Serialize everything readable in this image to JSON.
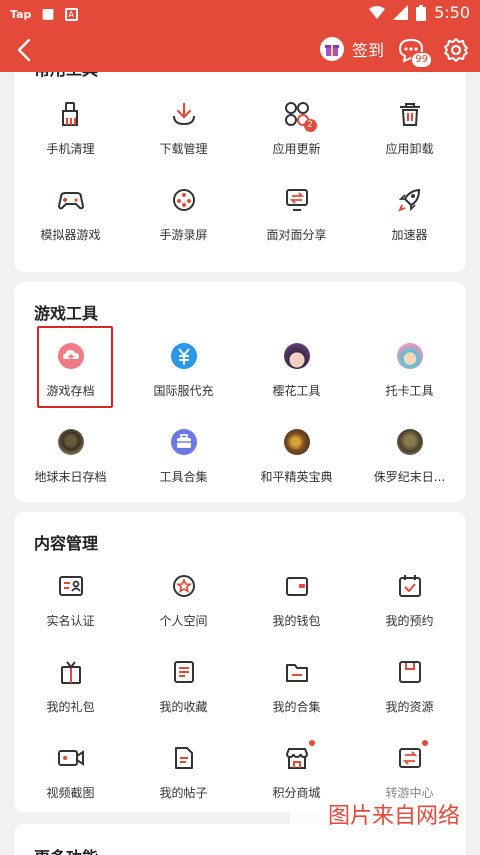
{
  "status_bar": {
    "left_app": "Tap",
    "time": "5:50"
  },
  "header": {
    "checkin_label": "签到",
    "message_count": "99"
  },
  "sections": {
    "common_tools": {
      "title": "常用工具",
      "items": [
        {
          "label": "手机清理",
          "icon": "broom-icon"
        },
        {
          "label": "下载管理",
          "icon": "download-icon"
        },
        {
          "label": "应用更新",
          "icon": "apps-update-icon",
          "badge": "2"
        },
        {
          "label": "应用卸载",
          "icon": "trash-icon"
        },
        {
          "label": "模拟器游戏",
          "icon": "gamepad-icon"
        },
        {
          "label": "手游录屏",
          "icon": "film-reel-icon"
        },
        {
          "label": "面对面分享",
          "icon": "transfer-icon"
        },
        {
          "label": "加速器",
          "icon": "rocket-icon"
        }
      ]
    },
    "game_tools": {
      "title": "游戏工具",
      "items": [
        {
          "label": "游戏存档",
          "icon": "cloud-upload-icon"
        },
        {
          "label": "国际服代充",
          "icon": "yuan-icon"
        },
        {
          "label": "樱花工具",
          "icon": "sakura-avatar-icon"
        },
        {
          "label": "托卡工具",
          "icon": "toca-avatar-icon"
        },
        {
          "label": "地球末日存档",
          "icon": "soldier-avatar-icon"
        },
        {
          "label": "工具合集",
          "icon": "toolbox-icon"
        },
        {
          "label": "和平精英宝典",
          "icon": "pubg-avatar-icon"
        },
        {
          "label": "侏罗纪末日...",
          "icon": "jurassic-avatar-icon"
        }
      ]
    },
    "content_mgmt": {
      "title": "内容管理",
      "items": [
        {
          "label": "实名认证",
          "icon": "id-card-icon"
        },
        {
          "label": "个人空间",
          "icon": "star-circle-icon"
        },
        {
          "label": "我的钱包",
          "icon": "wallet-icon"
        },
        {
          "label": "我的预约",
          "icon": "calendar-check-icon"
        },
        {
          "label": "我的礼包",
          "icon": "gift-icon"
        },
        {
          "label": "我的收藏",
          "icon": "list-box-icon"
        },
        {
          "label": "我的合集",
          "icon": "folder-icon"
        },
        {
          "label": "我的资源",
          "icon": "save-icon"
        },
        {
          "label": "视频截图",
          "icon": "video-icon"
        },
        {
          "label": "我的帖子",
          "icon": "document-icon"
        },
        {
          "label": "积分商城",
          "icon": "store-icon",
          "dot": true
        },
        {
          "label": "转游中心",
          "icon": "swap-icon",
          "dot": true
        }
      ]
    },
    "more": {
      "title": "更多功能"
    }
  },
  "watermark": "图片来自网络",
  "colors": {
    "accent": "#e44a3a",
    "background": "#f1f1f1",
    "highlight": "#d9242a"
  }
}
